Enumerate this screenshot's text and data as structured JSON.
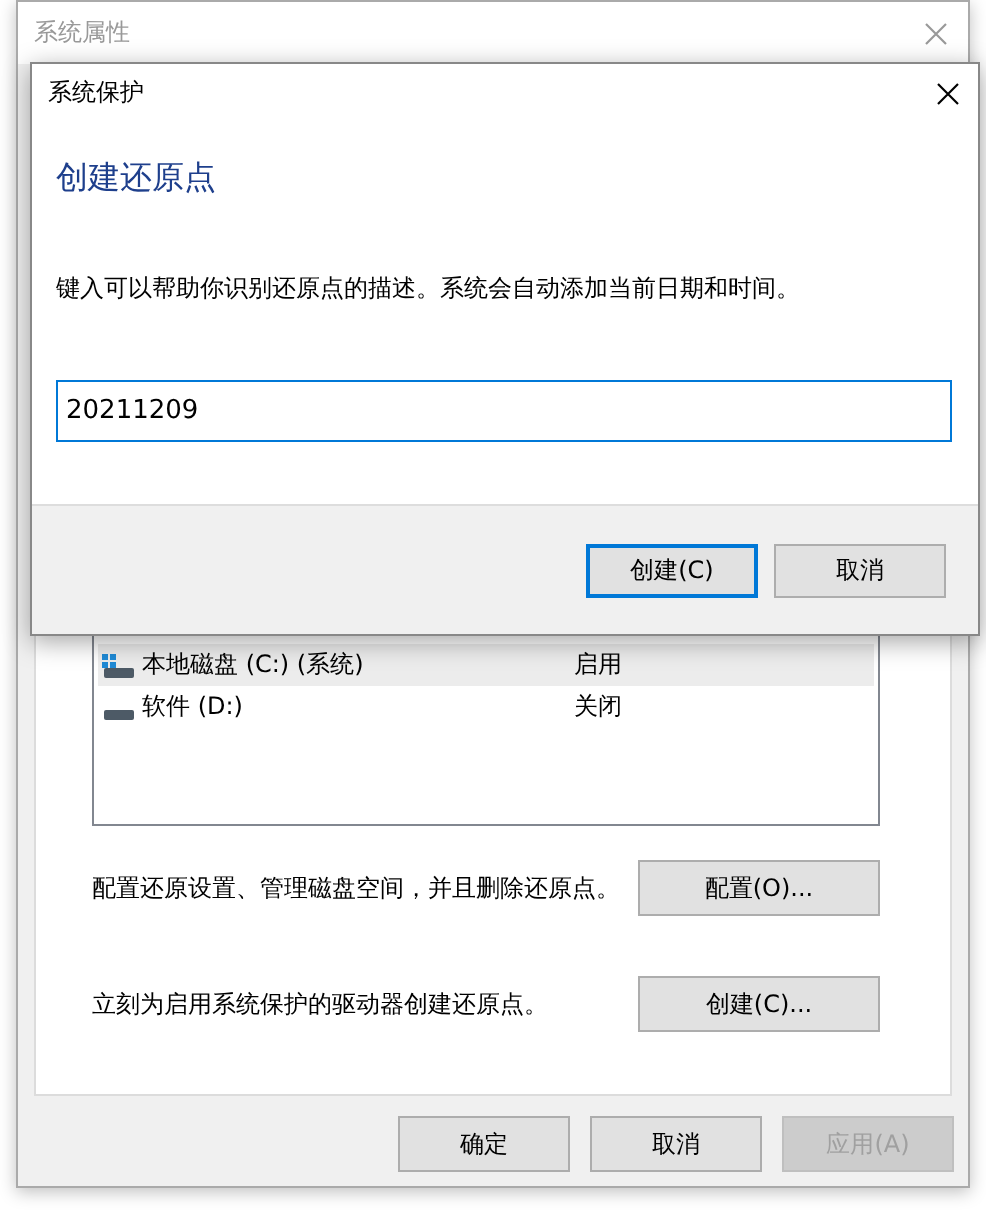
{
  "window": {
    "title": "系统属性"
  },
  "drives": {
    "rows": [
      {
        "name": "本地磁盘 (C:) (系统)",
        "protection": "启用",
        "kind": "system",
        "selected": true
      },
      {
        "name": "软件 (D:)",
        "protection": "关闭",
        "kind": "plain",
        "selected": false
      }
    ]
  },
  "actions": [
    {
      "text": "配置还原设置、管理磁盘空间，并且删除还原点。",
      "button": "配置(O)..."
    },
    {
      "text": "立刻为启用系统保护的驱动器创建还原点。",
      "button": "创建(C)..."
    }
  ],
  "buttons": [
    {
      "label": "确定",
      "disabled": false
    },
    {
      "label": "取消",
      "disabled": false
    },
    {
      "label": "应用(A)",
      "disabled": true
    }
  ],
  "dialog": {
    "title": "系统保护",
    "heading": "创建还原点",
    "description": "键入可以帮助你识别还原点的描述。系统会自动添加当前日期和时间。",
    "value": "20211209",
    "buttons": [
      {
        "label": "创建(C)",
        "default": true
      },
      {
        "label": "取消",
        "default": false
      }
    ]
  }
}
